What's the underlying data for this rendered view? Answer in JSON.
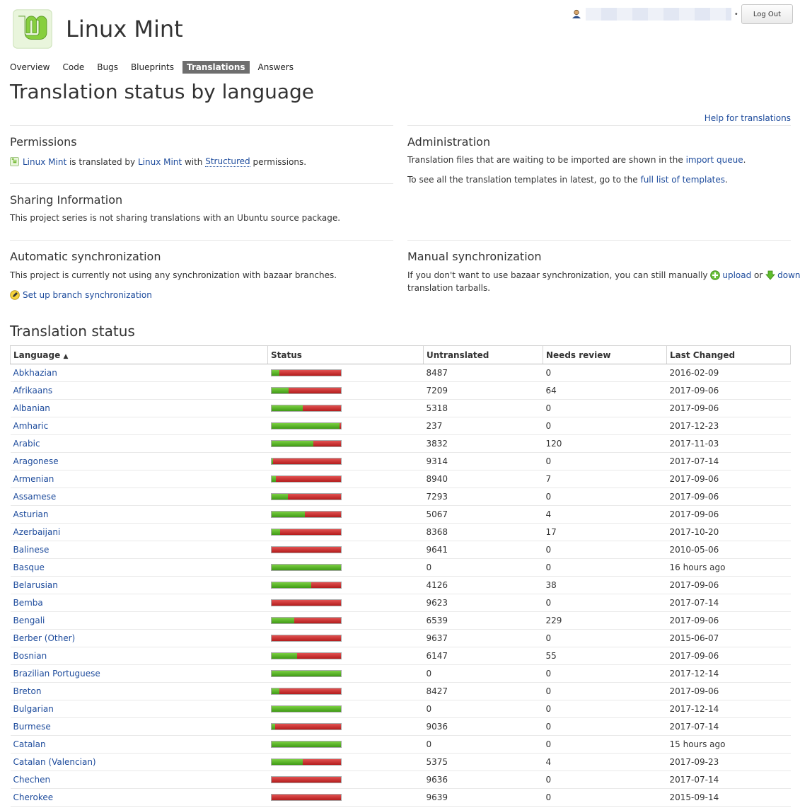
{
  "header": {
    "project_name": "Linux Mint",
    "logout_label": "Log Out",
    "logo_icon": "linux-mint-logo"
  },
  "tabs": [
    {
      "label": "Overview",
      "active": false
    },
    {
      "label": "Code",
      "active": false
    },
    {
      "label": "Bugs",
      "active": false
    },
    {
      "label": "Blueprints",
      "active": false
    },
    {
      "label": "Translations",
      "active": true
    },
    {
      "label": "Answers",
      "active": false
    }
  ],
  "page_title": "Translation status by language",
  "help_link": "Help for translations",
  "permissions": {
    "title": "Permissions",
    "project_link": "Linux Mint",
    "text1": " is translated by ",
    "group_link": "Linux Mint",
    "text2": " with ",
    "policy_link": "Structured",
    "text3": " permissions."
  },
  "administration": {
    "title": "Administration",
    "line1_pre": "Translation files that are waiting to be imported are shown in the ",
    "line1_link": "import queue",
    "line1_post": ".",
    "line2_pre": "To see all the translation templates in latest, go to the ",
    "line2_link": "full list of templates",
    "line2_post": "."
  },
  "sharing": {
    "title": "Sharing Information",
    "text": "This project series is not sharing translations with an Ubuntu source package."
  },
  "auto_sync": {
    "title": "Automatic synchronization",
    "text": "This project is currently not using any synchronization with bazaar branches.",
    "link": "Set up branch synchronization"
  },
  "manual_sync": {
    "title": "Manual synchronization",
    "pre": "If you don't want to use bazaar synchronization, you can still manually ",
    "upload": "upload",
    "or": " or ",
    "download": "download",
    "post": "translation tarballs."
  },
  "status": {
    "title": "Translation status",
    "columns": [
      "Language",
      "Status",
      "Untranslated",
      "Needs review",
      "Last Changed"
    ],
    "sort_indicator": "▲",
    "rows": [
      {
        "language": "Abkhazian",
        "translated": 0.12,
        "untranslated": "8487",
        "review": "0",
        "changed": "2016-02-09"
      },
      {
        "language": "Afrikaans",
        "translated": 0.25,
        "untranslated": "7209",
        "review": "64",
        "changed": "2017-09-06"
      },
      {
        "language": "Albanian",
        "translated": 0.45,
        "untranslated": "5318",
        "review": "0",
        "changed": "2017-09-06"
      },
      {
        "language": "Amharic",
        "translated": 0.98,
        "untranslated": "237",
        "review": "0",
        "changed": "2017-12-23"
      },
      {
        "language": "Arabic",
        "translated": 0.61,
        "untranslated": "3832",
        "review": "120",
        "changed": "2017-11-03"
      },
      {
        "language": "Aragonese",
        "translated": 0.03,
        "untranslated": "9314",
        "review": "0",
        "changed": "2017-07-14"
      },
      {
        "language": "Armenian",
        "translated": 0.07,
        "untranslated": "8940",
        "review": "7",
        "changed": "2017-09-06"
      },
      {
        "language": "Assamese",
        "translated": 0.24,
        "untranslated": "7293",
        "review": "0",
        "changed": "2017-09-06"
      },
      {
        "language": "Asturian",
        "translated": 0.48,
        "untranslated": "5067",
        "review": "4",
        "changed": "2017-09-06"
      },
      {
        "language": "Azerbaijani",
        "translated": 0.13,
        "untranslated": "8368",
        "review": "17",
        "changed": "2017-10-20"
      },
      {
        "language": "Balinese",
        "translated": 0.0,
        "untranslated": "9641",
        "review": "0",
        "changed": "2010-05-06"
      },
      {
        "language": "Basque",
        "translated": 1.0,
        "untranslated": "0",
        "review": "0",
        "changed": "16 hours ago"
      },
      {
        "language": "Belarusian",
        "translated": 0.58,
        "untranslated": "4126",
        "review": "38",
        "changed": "2017-09-06"
      },
      {
        "language": "Bemba",
        "translated": 0.0,
        "untranslated": "9623",
        "review": "0",
        "changed": "2017-07-14"
      },
      {
        "language": "Bengali",
        "translated": 0.33,
        "untranslated": "6539",
        "review": "229",
        "changed": "2017-09-06"
      },
      {
        "language": "Berber (Other)",
        "translated": 0.0,
        "untranslated": "9637",
        "review": "0",
        "changed": "2015-06-07"
      },
      {
        "language": "Bosnian",
        "translated": 0.37,
        "untranslated": "6147",
        "review": "55",
        "changed": "2017-09-06"
      },
      {
        "language": "Brazilian Portuguese",
        "translated": 1.0,
        "untranslated": "0",
        "review": "0",
        "changed": "2017-12-14"
      },
      {
        "language": "Breton",
        "translated": 0.12,
        "untranslated": "8427",
        "review": "0",
        "changed": "2017-09-06"
      },
      {
        "language": "Bulgarian",
        "translated": 1.0,
        "untranslated": "0",
        "review": "0",
        "changed": "2017-12-14"
      },
      {
        "language": "Burmese",
        "translated": 0.06,
        "untranslated": "9036",
        "review": "0",
        "changed": "2017-07-14"
      },
      {
        "language": "Catalan",
        "translated": 1.0,
        "untranslated": "0",
        "review": "0",
        "changed": "15 hours ago"
      },
      {
        "language": "Catalan (Valencian)",
        "translated": 0.45,
        "untranslated": "5375",
        "review": "4",
        "changed": "2017-09-23"
      },
      {
        "language": "Chechen",
        "translated": 0.0,
        "untranslated": "9636",
        "review": "0",
        "changed": "2017-07-14"
      },
      {
        "language": "Cherokee",
        "translated": 0.0,
        "untranslated": "9639",
        "review": "0",
        "changed": "2015-09-14"
      }
    ]
  }
}
